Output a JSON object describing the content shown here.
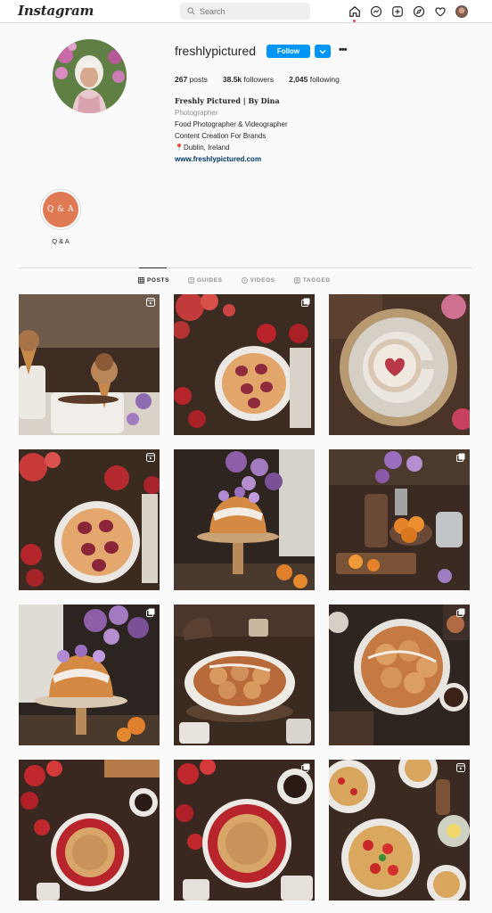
{
  "nav": {
    "logo": "Instagram",
    "search_placeholder": "Search",
    "icons": [
      "home-icon",
      "messenger-icon",
      "new-post-icon",
      "explore-icon",
      "activity-heart-icon",
      "profile-avatar"
    ]
  },
  "profile": {
    "username": "freshlypictured",
    "follow_label": "Follow",
    "stats": {
      "posts_count": "267",
      "posts_label": "posts",
      "followers_count": "38.5k",
      "followers_label": "followers",
      "following_count": "2,045",
      "following_label": "following"
    },
    "bio": {
      "name": "Freshly Pictured | By Dina",
      "category": "Photographer",
      "line1": "Food Photographer & Videographer",
      "line2": "Content Creation For Brands",
      "location": "📍Dublin, Ireland",
      "website": "www.freshlypictured.com"
    }
  },
  "highlights": [
    {
      "cover_text": "Q & A",
      "label": "Q & A"
    }
  ],
  "tabs": [
    {
      "label": "POSTS",
      "active": true,
      "icon": "grid-icon"
    },
    {
      "label": "GUIDES",
      "active": false,
      "icon": "guides-icon"
    },
    {
      "label": "VIDEOS",
      "active": false,
      "icon": "video-icon"
    },
    {
      "label": "TAGGED",
      "active": false,
      "icon": "tagged-icon"
    }
  ],
  "colors": {
    "accent": "#0095f6",
    "highlight_cover": "#e07a55",
    "link": "#00376b"
  },
  "posts": [
    {
      "subject": "ice cream cones in coffee cups",
      "type": "reel"
    },
    {
      "subject": "plum tart with red flowers",
      "type": "carousel"
    },
    {
      "subject": "latte with heart in cup",
      "type": "image"
    },
    {
      "subject": "plum tart with apples",
      "type": "reel"
    },
    {
      "subject": "glazed bundt cake with lilacs",
      "type": "image"
    },
    {
      "subject": "oranges and pastry still life",
      "type": "carousel"
    },
    {
      "subject": "bundt cake with lilacs",
      "type": "carousel"
    },
    {
      "subject": "cinnamon rolls in dish",
      "type": "image"
    },
    {
      "subject": "cinnamon rolls on plate",
      "type": "carousel"
    },
    {
      "subject": "pomegranate tart",
      "type": "image"
    },
    {
      "subject": "pomegranate tart with coffee",
      "type": "carousel"
    },
    {
      "subject": "tomato pasta bowls",
      "type": "reel"
    }
  ]
}
